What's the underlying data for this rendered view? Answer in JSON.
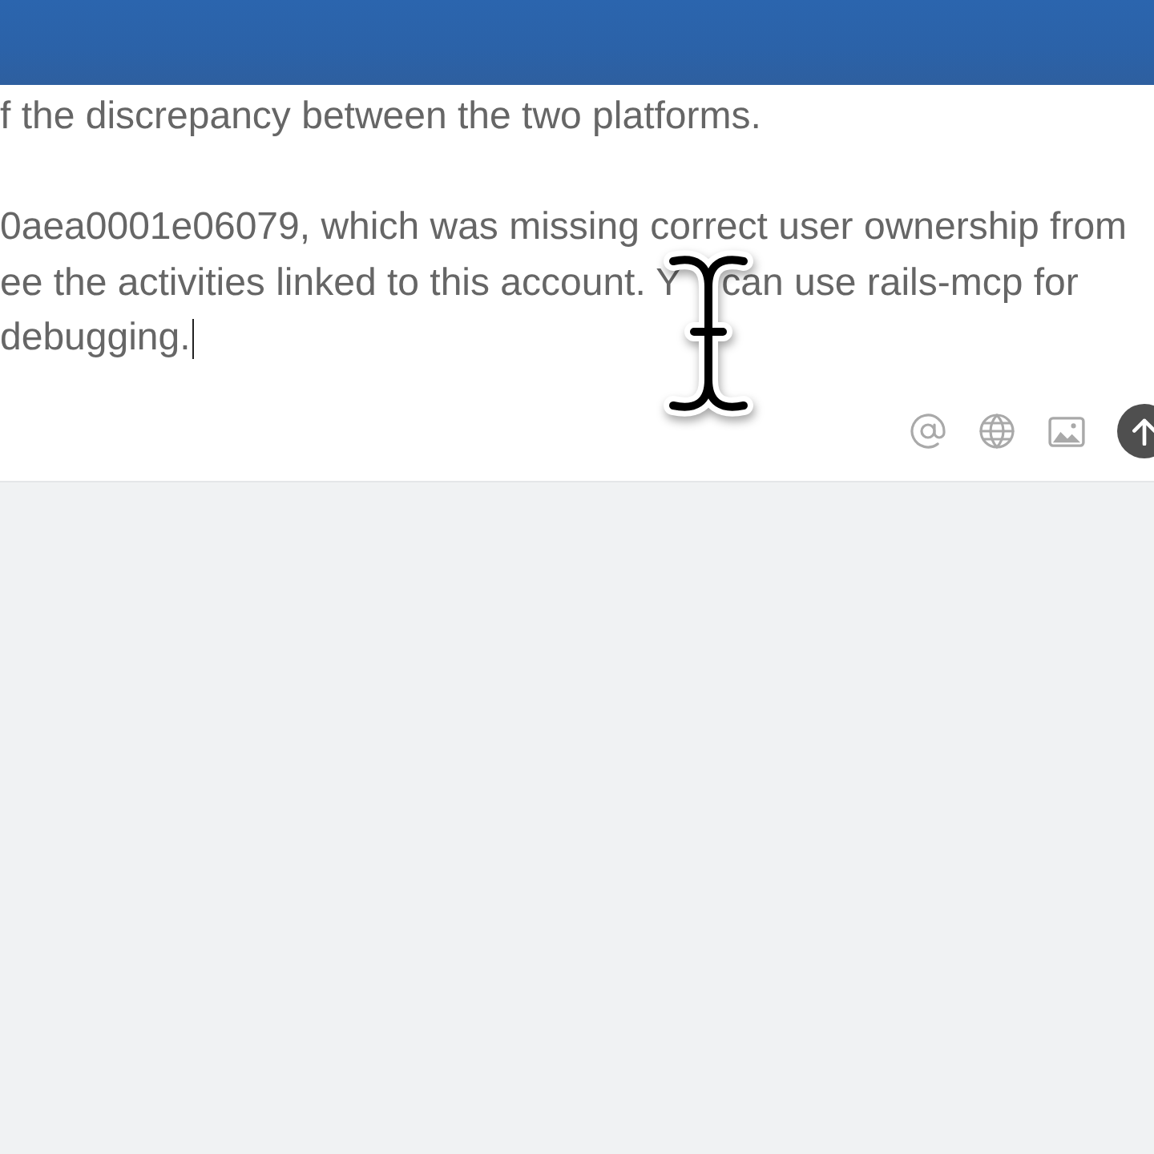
{
  "composer": {
    "paragraphs": [
      {
        "lines": [
          {
            "parts": [
              "f the discrepancy between the two platforms."
            ]
          }
        ]
      },
      {
        "lines": [
          {
            "parts": [
              "0aea0001e06079, which was missing correct user ownership from"
            ]
          },
          {
            "parts": [
              "ee the activities linked to this account. Y",
              "can use rails-mcp for"
            ]
          },
          {
            "parts": [
              "debugging."
            ]
          }
        ]
      }
    ],
    "caret": true
  }
}
